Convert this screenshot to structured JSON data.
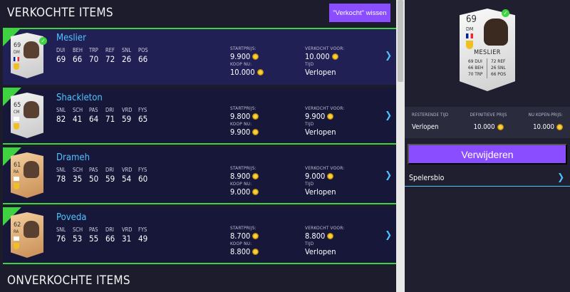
{
  "sold_section": {
    "title": "VERKOCHTE ITEMS",
    "clear_button": "\"Verkocht\" wissen"
  },
  "unsold_section": {
    "title": "ONVERKOCHTE ITEMS"
  },
  "labels": {
    "start_price": "STARTPRIJS:",
    "buy_now": "KOOP NU:",
    "sold_for": "VERKOCHT VOOR:",
    "time": "TIJD"
  },
  "accent_colors": {
    "sold_green": "#3fd342",
    "purple": "#8a4dff",
    "link_blue": "#4fc3ff"
  },
  "items": [
    {
      "name": "Meslier",
      "rating": "69",
      "position": "DM",
      "card": "silver",
      "attrs": [
        {
          "l": "DUI",
          "v": "69"
        },
        {
          "l": "BEH",
          "v": "66"
        },
        {
          "l": "TRP",
          "v": "70"
        },
        {
          "l": "REF",
          "v": "72"
        },
        {
          "l": "SNL",
          "v": "26"
        },
        {
          "l": "POS",
          "v": "66"
        }
      ],
      "start_price": "9.900",
      "buy_now": "10.000",
      "sold_for": "10.000",
      "time": "Verlopen"
    },
    {
      "name": "Shackleton",
      "rating": "65",
      "position": "CM",
      "card": "silver",
      "attrs": [
        {
          "l": "SNL",
          "v": "82"
        },
        {
          "l": "SCH",
          "v": "41"
        },
        {
          "l": "PAS",
          "v": "64"
        },
        {
          "l": "DRI",
          "v": "71"
        },
        {
          "l": "VRD",
          "v": "59"
        },
        {
          "l": "FYS",
          "v": "65"
        }
      ],
      "start_price": "9.800",
      "buy_now": "9.900",
      "sold_for": "9.900",
      "time": "Verlopen"
    },
    {
      "name": "Drameh",
      "rating": "61",
      "position": "RA",
      "card": "bronze",
      "attrs": [
        {
          "l": "SNL",
          "v": "78"
        },
        {
          "l": "SCH",
          "v": "35"
        },
        {
          "l": "PAS",
          "v": "50"
        },
        {
          "l": "DRI",
          "v": "59"
        },
        {
          "l": "VRD",
          "v": "54"
        },
        {
          "l": "FYS",
          "v": "60"
        }
      ],
      "start_price": "8.900",
      "buy_now": "9.000",
      "sold_for": "9.000",
      "time": "Verlopen"
    },
    {
      "name": "Poveda",
      "rating": "62",
      "position": "RA",
      "card": "bronze",
      "attrs": [
        {
          "l": "SNL",
          "v": "76"
        },
        {
          "l": "SCH",
          "v": "53"
        },
        {
          "l": "PAS",
          "v": "55"
        },
        {
          "l": "DRI",
          "v": "66"
        },
        {
          "l": "VRD",
          "v": "31"
        },
        {
          "l": "FYS",
          "v": "49"
        }
      ],
      "start_price": "8.700",
      "buy_now": "8.800",
      "sold_for": "8.800",
      "time": "Verlopen"
    }
  ],
  "detail": {
    "rating": "69",
    "position": "DM",
    "name": "MESLIER",
    "stats_left": [
      "69 DUI",
      "66 BEH",
      "70 TRP"
    ],
    "stats_right": [
      "72 REF",
      "26 SNL",
      "66 POS"
    ],
    "remaining_time_label": "RESTERENDE TIJD",
    "remaining_time": "Verlopen",
    "final_price_label": "DEFINITIEVE PRIJS",
    "final_price": "10.000",
    "buy_now_label": "NU KOPEN-PRIJS:",
    "buy_now": "10.000",
    "delete_button": "Verwijderen",
    "bio_link": "Spelersbio"
  }
}
